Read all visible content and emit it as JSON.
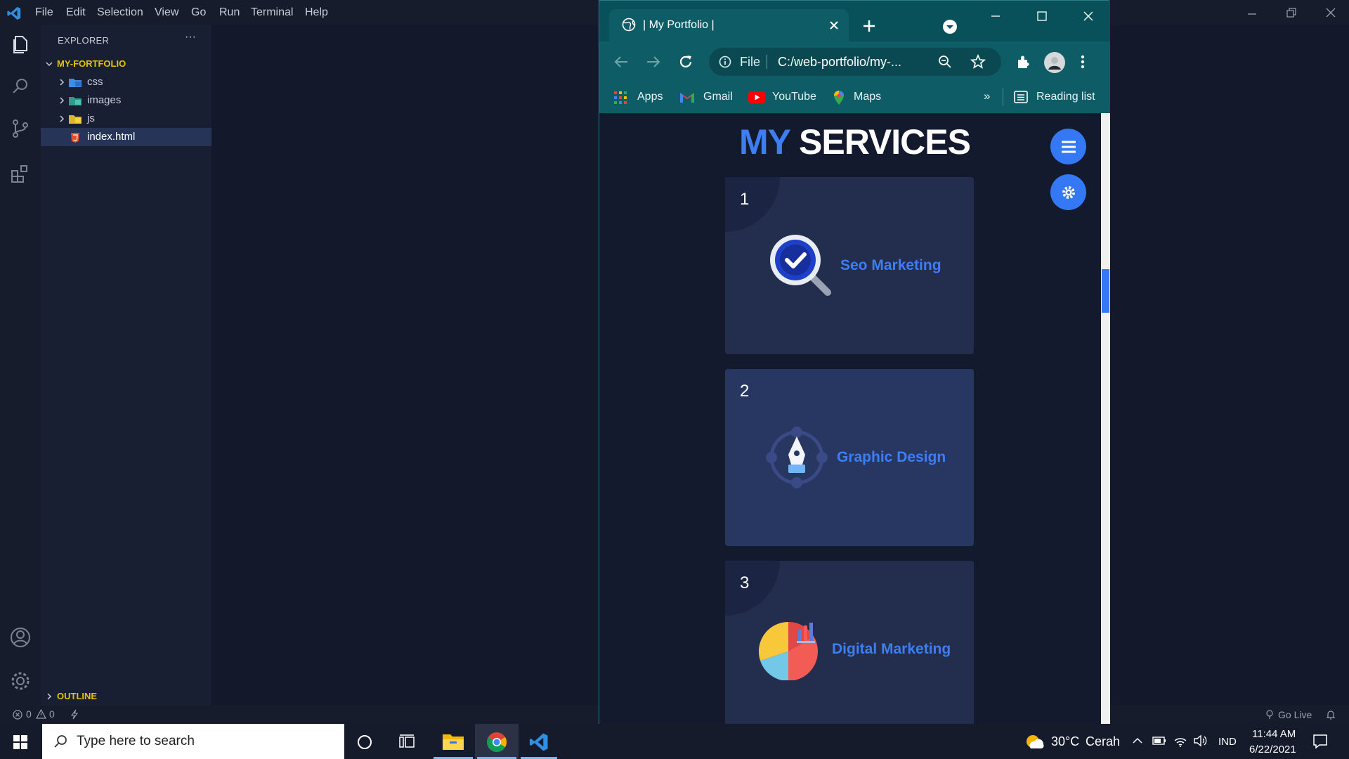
{
  "vscode": {
    "menu": [
      "File",
      "Edit",
      "Selection",
      "View",
      "Go",
      "Run",
      "Terminal",
      "Help"
    ],
    "explorer_title": "EXPLORER",
    "explorer_more": "···",
    "project_name": "MY-FORTFOLIO",
    "tree": [
      {
        "label": "css",
        "type": "folder"
      },
      {
        "label": "images",
        "type": "folder"
      },
      {
        "label": "js",
        "type": "folder"
      },
      {
        "label": "index.html",
        "type": "file"
      }
    ],
    "outline_label": "OUTLINE",
    "status": {
      "errors": "0",
      "warnings": "0",
      "go_live": "Go Live"
    }
  },
  "chrome": {
    "tab_title": "| My Portfolio |",
    "omnibox_prefix": "File",
    "omnibox_url": "C:/web-portfolio/my-...",
    "bookmarks": [
      {
        "label": "Apps",
        "icon": "apps-grid-icon"
      },
      {
        "label": "Gmail",
        "icon": "gmail-icon"
      },
      {
        "label": "YouTube",
        "icon": "youtube-icon"
      },
      {
        "label": "Maps",
        "icon": "maps-icon"
      }
    ],
    "overflow": "»",
    "reading_list": "Reading list"
  },
  "page": {
    "heading_accent": "MY",
    "heading_rest": "SERVICES",
    "services": [
      {
        "number": "1",
        "title": "Seo Marketing",
        "icon": "seo-magnifier-check-icon"
      },
      {
        "number": "2",
        "title": "Graphic Design",
        "icon": "pen-tool-icon"
      },
      {
        "number": "3",
        "title": "Digital Marketing",
        "icon": "pie-chart-icon"
      }
    ],
    "accent_color": "#3d7ef5"
  },
  "taskbar": {
    "search_placeholder": "Type here to search",
    "weather_temp": "30°C",
    "weather_desc": "Cerah",
    "lang": "IND",
    "time": "11:44 AM",
    "date": "6/22/2021"
  }
}
